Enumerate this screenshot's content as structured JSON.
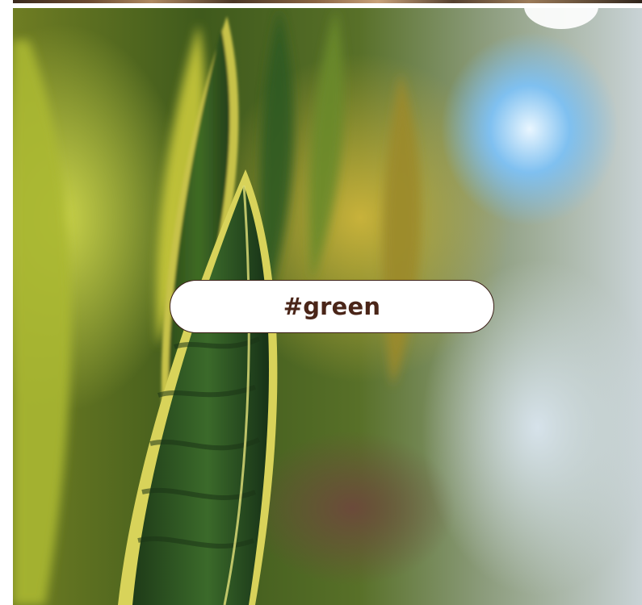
{
  "tiles": {
    "current": {
      "hashtag_label": "#green",
      "image_subject": "snake-plant"
    }
  },
  "colors": {
    "pill_background": "#ffffff",
    "pill_border": "#3b1f17",
    "pill_text": "#4a2518"
  }
}
